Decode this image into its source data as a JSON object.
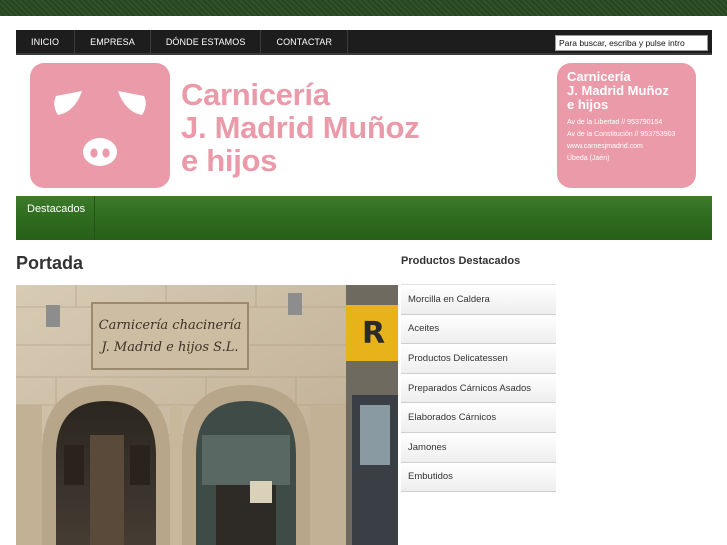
{
  "nav": {
    "items": [
      "INICIO",
      "EMPRESA",
      "DÓNDE ESTAMOS",
      "CONTACTAR"
    ],
    "search_value": "Para buscar, escriba y pulse intro"
  },
  "header": {
    "logo_lines": [
      "Carnicería",
      "J. Madrid Muñoz",
      "e hijos"
    ],
    "card": {
      "name_lines": [
        "Carnicería",
        "J. Madrid Muñoz",
        "e hijos"
      ],
      "lines": [
        "Av de la Libertad // 953790154",
        "Av de la Constitución // 953753903",
        "www.carnesjmadrid.com",
        "Úbeda (Jaén)"
      ]
    },
    "brand_pink": "#ea9aa8"
  },
  "greenbar": {
    "items": [
      "Destacados"
    ],
    "color": "#2e6a1e"
  },
  "main": {
    "title": "Portada",
    "photo_sign_lines": [
      "Carnicería chacinería",
      "J. Madrid e hijos S.L."
    ],
    "photo_right_letter": "R"
  },
  "sidebar": {
    "title": "Productos Destacados",
    "items": [
      "Morcilla en Caldera",
      "Aceites",
      "Productos Delicatessen",
      "Preparados Cárnicos Asados",
      "Elaborados Cárnicos",
      "Jamones",
      "Embutidos"
    ]
  }
}
